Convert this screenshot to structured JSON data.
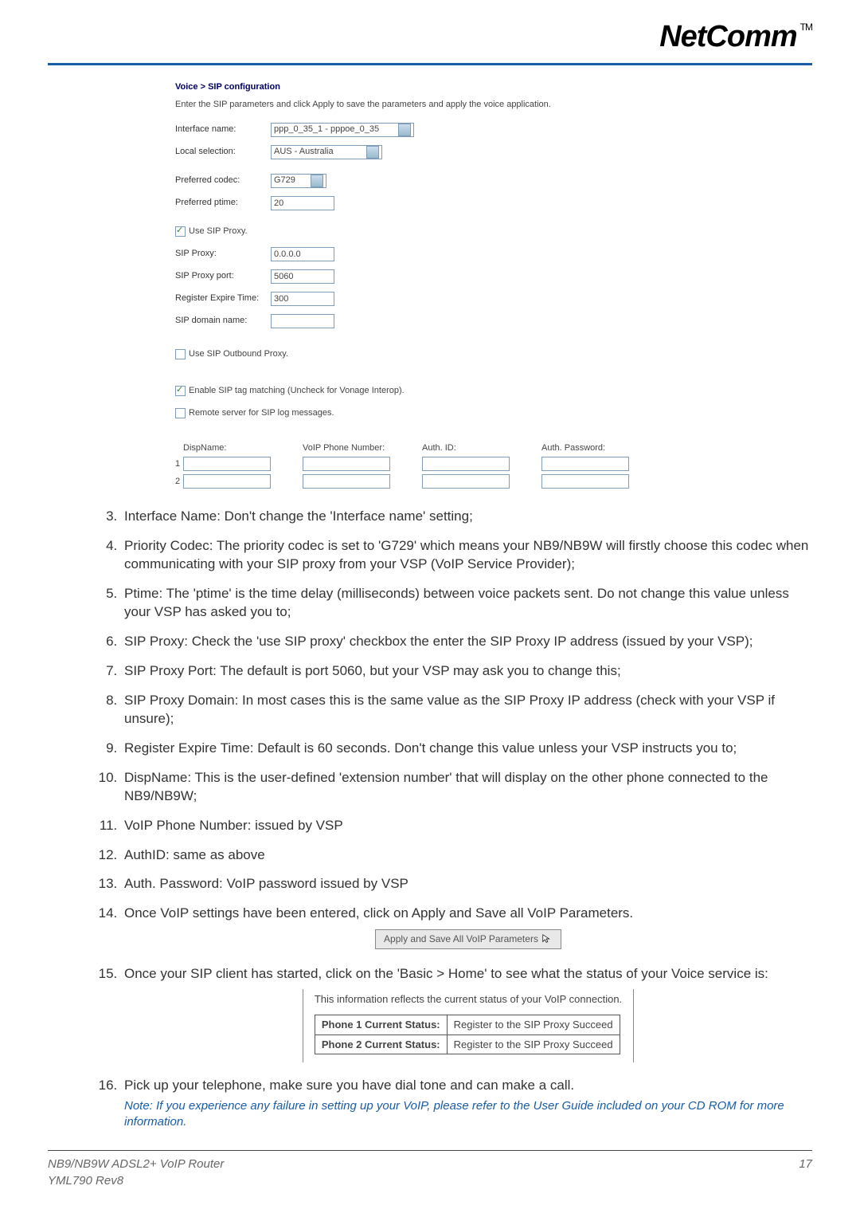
{
  "header": {
    "brand": "NetComm",
    "tm": "TM"
  },
  "screenshot": {
    "title": "Voice > SIP configuration",
    "subtitle": "Enter the SIP parameters and click Apply to save the parameters and apply the voice application.",
    "interface_label": "Interface name:",
    "interface_value": "ppp_0_35_1 - pppoe_0_35",
    "local_label": "Local selection:",
    "local_value": "AUS - Australia",
    "codec_label": "Preferred codec:",
    "codec_value": "G729",
    "ptime_label": "Preferred ptime:",
    "ptime_value": "20",
    "use_sip_label": "Use SIP Proxy.",
    "sip_proxy_label": "SIP Proxy:",
    "sip_proxy_value": "0.0.0.0",
    "sip_port_label": "SIP Proxy port:",
    "sip_port_value": "5060",
    "reg_expire_label": "Register Expire Time:",
    "reg_expire_value": "300",
    "sip_domain_label": "SIP domain name:",
    "outbound_label": "Use SIP Outbound Proxy.",
    "tagmatch_label": "Enable SIP tag matching (Uncheck for Vonage Interop).",
    "remote_log_label": "Remote server for SIP log messages.",
    "col_disp": "DispName:",
    "col_voip": "VoIP Phone Number:",
    "col_auth": "Auth. ID:",
    "col_pass": "Auth. Password:",
    "row1": "1",
    "row2": "2"
  },
  "instructions": {
    "i3": "Interface Name: Don't change the 'Interface name' setting;",
    "i4": "Priority Codec: The priority codec is set to 'G729' which means your NB9/NB9W will firstly choose this codec when communicating with your SIP proxy from your VSP (VoIP Service Provider);",
    "i5": "Ptime: The 'ptime' is the time delay (milliseconds) between voice packets sent. Do not change this value unless your VSP has asked you to;",
    "i6": "SIP Proxy: Check the 'use SIP proxy' checkbox the enter the SIP Proxy IP address (issued by your VSP);",
    "i7": "SIP Proxy Port: The default is port 5060, but your VSP may ask you to change this;",
    "i8": "SIP Proxy Domain: In most cases this is the same value as the SIP Proxy IP address (check with your VSP if unsure);",
    "i9": "Register Expire Time: Default is 60 seconds. Don't change this value unless your VSP instructs you to;",
    "i10": "DispName: This is the user-defined 'extension number' that will display on the other phone connected to the NB9/NB9W;",
    "i11": "VoIP Phone Number: issued by VSP",
    "i12": "AuthID: same as above",
    "i13": "Auth. Password: VoIP password issued by VSP",
    "i14": "Once VoIP settings have been entered, click on Apply and Save all VoIP Parameters.",
    "i15": "Once your SIP client has started, click on the 'Basic > Home' to see what the status of your Voice service is:",
    "i16": "Pick up your telephone, make sure you have dial tone and can make a call.",
    "apply_btn": "Apply and Save All VoIP Parameters",
    "status_caption": "This information reflects the current status of your VoIP connection.",
    "phone1_label": "Phone 1 Current Status:",
    "phone1_value": "Register to the SIP Proxy Succeed",
    "phone2_label": "Phone 2 Current Status:",
    "phone2_value": "Register to the SIP Proxy Succeed",
    "note": "Note: If you experience any failure in setting up your VoIP, please refer to the User Guide included on your CD ROM for more information."
  },
  "footer": {
    "left_line1": "NB9/NB9W ADSL2+ VoIP Router",
    "left_line2": "YML790 Rev8",
    "page_number": "17"
  }
}
